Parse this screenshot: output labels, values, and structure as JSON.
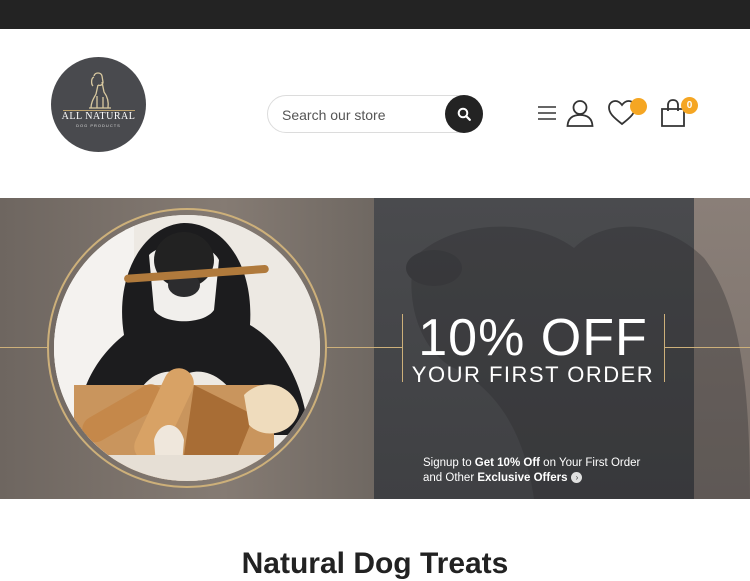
{
  "header": {
    "logo": {
      "name": "ALL NATURAL",
      "tagline": "DOG PRODUCTS"
    },
    "search": {
      "placeholder": "Search our store"
    },
    "wishlist_count": "",
    "cart_count": "0",
    "icons": [
      "menu-icon",
      "user-icon",
      "heart-icon",
      "shopping-bag-icon",
      "search-icon"
    ],
    "badge_color": "#f5a623"
  },
  "banner": {
    "headline": "10% OFF",
    "subheadline": "YOUR FIRST ORDER",
    "signup_prefix": "Signup to ",
    "signup_bold1": "Get 10% Off",
    "signup_middle": " on Your First Order",
    "signup_line2_prefix": "and Other ",
    "signup_bold2": "Exclusive Offers",
    "accent_color": "#cdb07a"
  },
  "section": {
    "title": "Natural Dog Treats"
  }
}
